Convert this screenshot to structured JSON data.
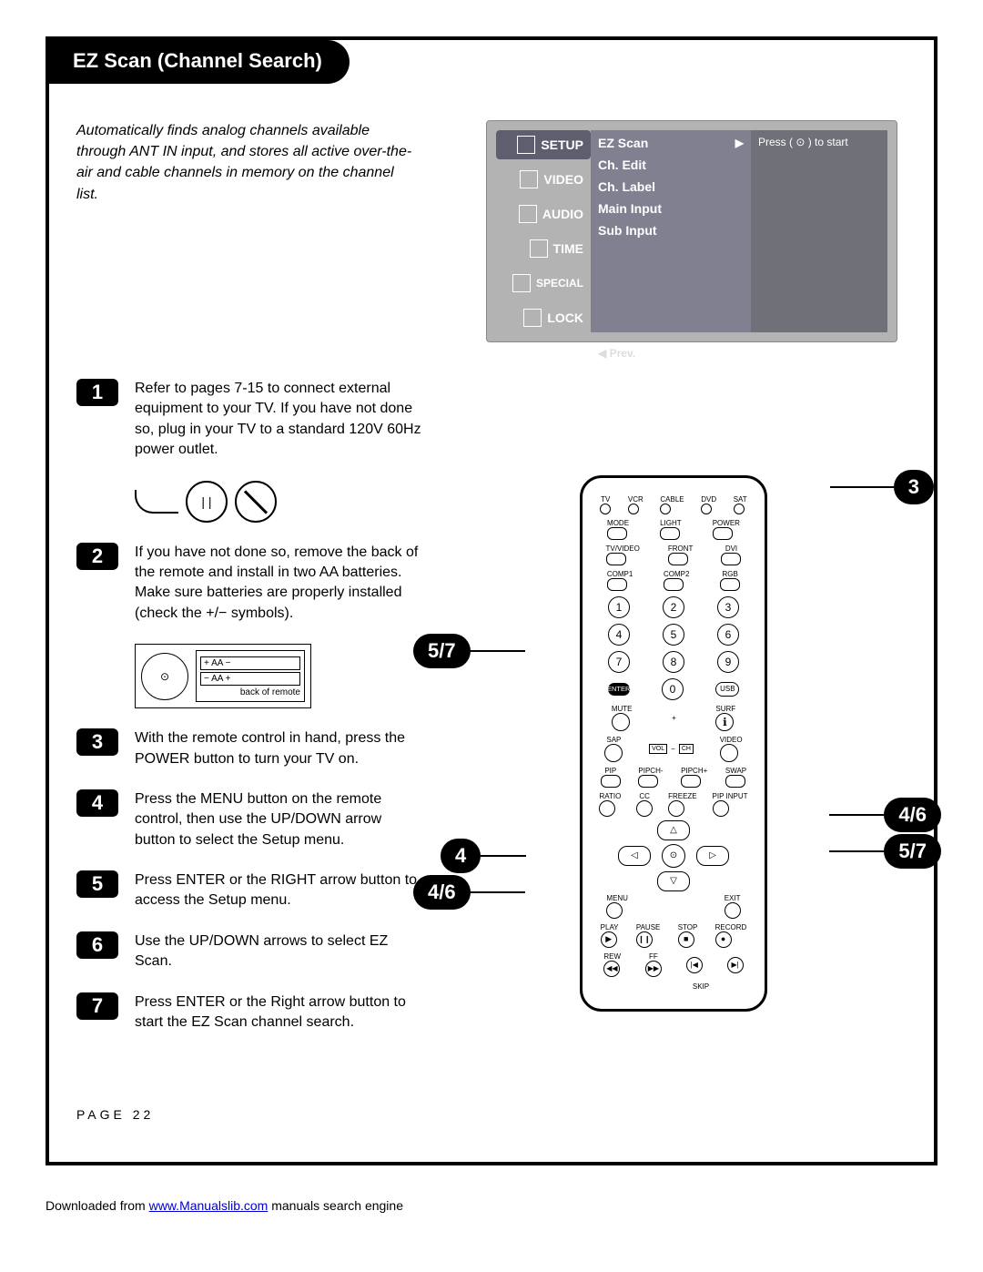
{
  "title": "EZ Scan (Channel Search)",
  "intro": "Automatically finds analog channels available through ANT IN input, and stores all active over-the-air and cable channels in memory on the channel list.",
  "osd": {
    "tabs": [
      "SETUP",
      "VIDEO",
      "AUDIO",
      "TIME",
      "SPECIAL",
      "LOCK"
    ],
    "items": [
      "EZ Scan",
      "Ch. Edit",
      "Ch. Label",
      "Main Input",
      "Sub Input"
    ],
    "hint": "Press ( ⊙ ) to start",
    "prev": "◀ Prev."
  },
  "steps": [
    {
      "num": "1",
      "text": "Refer to pages 7-15 to connect external equipment to your TV. If you have not done so, plug in your TV to a standard 120V 60Hz power outlet."
    },
    {
      "num": "2",
      "text": "If you have not done so, remove the back of the remote and install in two AA batteries. Make sure batteries are properly installed (check the +/− symbols)."
    },
    {
      "num": "3",
      "text": "With the remote control in hand, press the POWER button to turn your TV on."
    },
    {
      "num": "4",
      "text": "Press the MENU button on the remote control, then use the UP/DOWN arrow button to select the Setup menu."
    },
    {
      "num": "5",
      "text": "Press ENTER or the RIGHT arrow button to access the Setup menu."
    },
    {
      "num": "6",
      "text": "Use the UP/DOWN arrows to select EZ Scan."
    },
    {
      "num": "7",
      "text": "Press ENTER or the Right arrow button to start the EZ Scan channel search."
    }
  ],
  "aa_label": "back of remote",
  "remote": {
    "toprow": [
      "TV",
      "VCR",
      "CABLE",
      "DVD",
      "SAT"
    ],
    "row_mlp": [
      "MODE",
      "LIGHT",
      "POWER"
    ],
    "row_inputs1": [
      "TV/VIDEO",
      "FRONT",
      "DVI"
    ],
    "row_inputs2": [
      "COMP1",
      "COMP2",
      "RGB"
    ],
    "keypad": [
      [
        "1",
        "2",
        "3"
      ],
      [
        "4",
        "5",
        "6"
      ],
      [
        "7",
        "8",
        "9"
      ]
    ],
    "zero_row": {
      "enter": "ENTER",
      "zero": "0",
      "usb": "USB"
    },
    "mute_surf": [
      "MUTE",
      "",
      "SURF"
    ],
    "sap_video": [
      "SAP",
      "",
      "VIDEO"
    ],
    "vol_ch": {
      "vol": "VOL",
      "ch": "CH"
    },
    "pip_row": [
      "PIP",
      "PIPCH-",
      "PIPCH+",
      "SWAP"
    ],
    "ratio_row": [
      "RATIO",
      "CC",
      "FREEZE",
      "PIP INPUT"
    ],
    "menu_exit": {
      "menu": "MENU",
      "exit": "EXIT"
    },
    "play_row": [
      "PLAY",
      "PAUSE",
      "STOP",
      "RECORD"
    ],
    "play_sym": [
      "▶",
      "❙❙",
      "■",
      "●"
    ],
    "rew_row": [
      "REW",
      "FF",
      "",
      ""
    ],
    "rew_sym": [
      "◀◀",
      "▶▶",
      "|◀",
      "▶|"
    ],
    "skip": "SKIP"
  },
  "callouts": {
    "c3": "3",
    "c57_left": "5/7",
    "c46_left": "4/6",
    "c4": "4",
    "c46_right": "4/6",
    "c57_right": "5/7"
  },
  "page_number": "PAGE 22",
  "footer": {
    "prefix": "Downloaded from ",
    "link": "www.Manualslib.com",
    "suffix": " manuals search engine"
  }
}
